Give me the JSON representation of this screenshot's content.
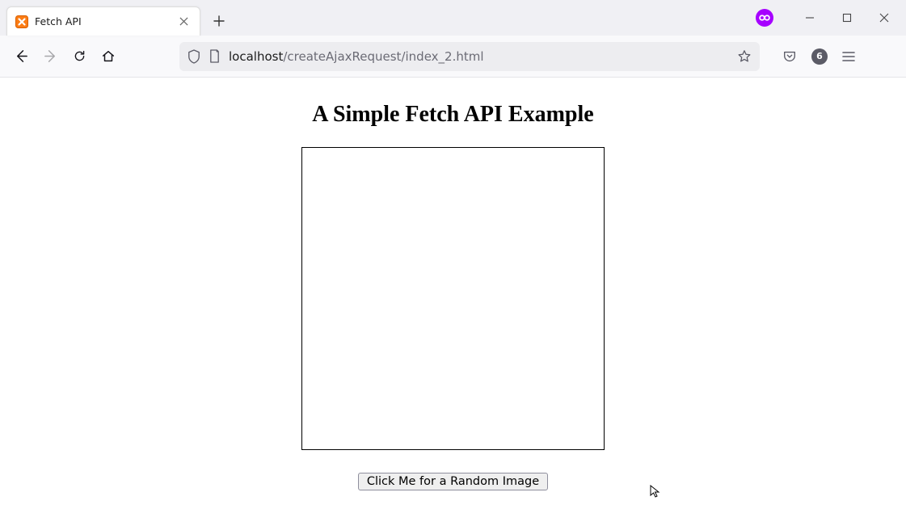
{
  "browser": {
    "tab": {
      "title": "Fetch API",
      "favicon": "xampp-icon"
    },
    "url": {
      "host": "localhost",
      "path": "/createAjaxRequest/index_2.html"
    },
    "extension_badge": "∞",
    "notification_count": "6"
  },
  "page": {
    "heading": "A Simple Fetch API Example",
    "button_label": "Click Me for a Random Image"
  }
}
